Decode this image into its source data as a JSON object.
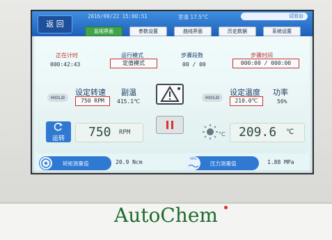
{
  "topbar": {
    "back_label": "返 回",
    "datetime": "2016/09/22 15:00:51",
    "room_temp": "室温 17.5°C",
    "test_label": "试验台",
    "tabs": [
      "监视界面",
      "参数设置",
      "曲线界面",
      "历史数据",
      "系统设置"
    ],
    "active_tab_index": 0
  },
  "status": {
    "timer_label": "正在计时",
    "timer_value": "000:42:43",
    "mode_label": "运行模式",
    "mode_value": "定值模式",
    "steps_label": "步骤段数",
    "steps_value": "00 / 00",
    "step_time_label": "步骤时间",
    "step_time_value": "000:00  /  000:00"
  },
  "stirring": {
    "hold_label": "HOLD",
    "set_speed_label": "设定转速",
    "set_speed_value": "750 RPM",
    "aux_temp_label": "副温",
    "aux_temp_value": "415.1℃",
    "run_label": "运转",
    "speed_value": "750",
    "speed_unit": "RPM"
  },
  "heating": {
    "hold_label": "HOLD",
    "set_temp_label": "设定温度",
    "set_temp_value": "210.0℃",
    "power_label": "功率",
    "power_value": "56%",
    "temp_value": "209.6",
    "temp_unit": "℃",
    "heater_unit": "°C"
  },
  "meters": {
    "torque_label": "转矩测量值",
    "torque_value": "20.9 Ncm",
    "pressure_label": "压力测量值",
    "pressure_value": "1.88 MPa",
    "pressure_icon_text": "MPa"
  },
  "brand": {
    "name": "AutoChem"
  },
  "colors": {
    "accent_blue": "#2f79d2",
    "active_tab": "#41a34a",
    "warning_red": "#c0332e",
    "brand_green": "#1d6b2c"
  }
}
